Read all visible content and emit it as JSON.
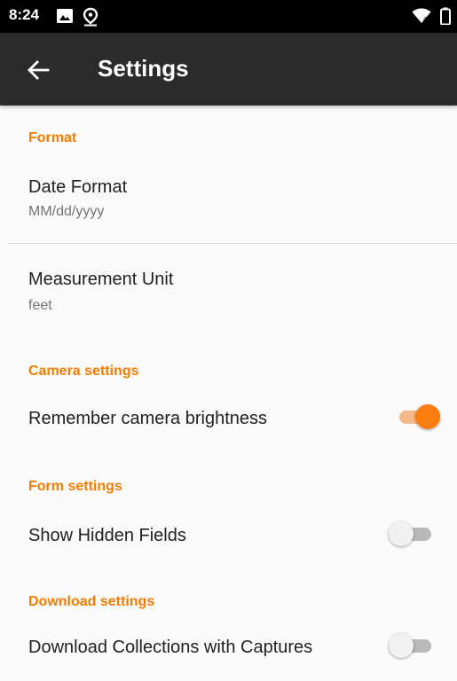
{
  "status_bar": {
    "time": "8:24",
    "icons": [
      "image-icon",
      "location-icon",
      "wifi-icon",
      "battery-icon"
    ]
  },
  "app_bar": {
    "title": "Settings",
    "back_icon": "arrow-back-icon"
  },
  "colors": {
    "accent": "#f57c00",
    "app_bar": "#2b2b2b",
    "status_bar": "#000000",
    "background": "#fafafa"
  },
  "sections": {
    "format": {
      "header": "Format",
      "date_format": {
        "title": "Date Format",
        "summary": "MM/dd/yyyy"
      },
      "measurement_unit": {
        "title": "Measurement Unit",
        "summary": "feet"
      }
    },
    "camera": {
      "header": "Camera settings",
      "remember_brightness": {
        "title": "Remember camera brightness",
        "checked": true
      }
    },
    "form": {
      "header": "Form settings",
      "show_hidden_fields": {
        "title": "Show Hidden Fields",
        "checked": false
      }
    },
    "download": {
      "header": "Download settings",
      "download_collections": {
        "title": "Download Collections with Captures",
        "checked": false
      }
    }
  }
}
